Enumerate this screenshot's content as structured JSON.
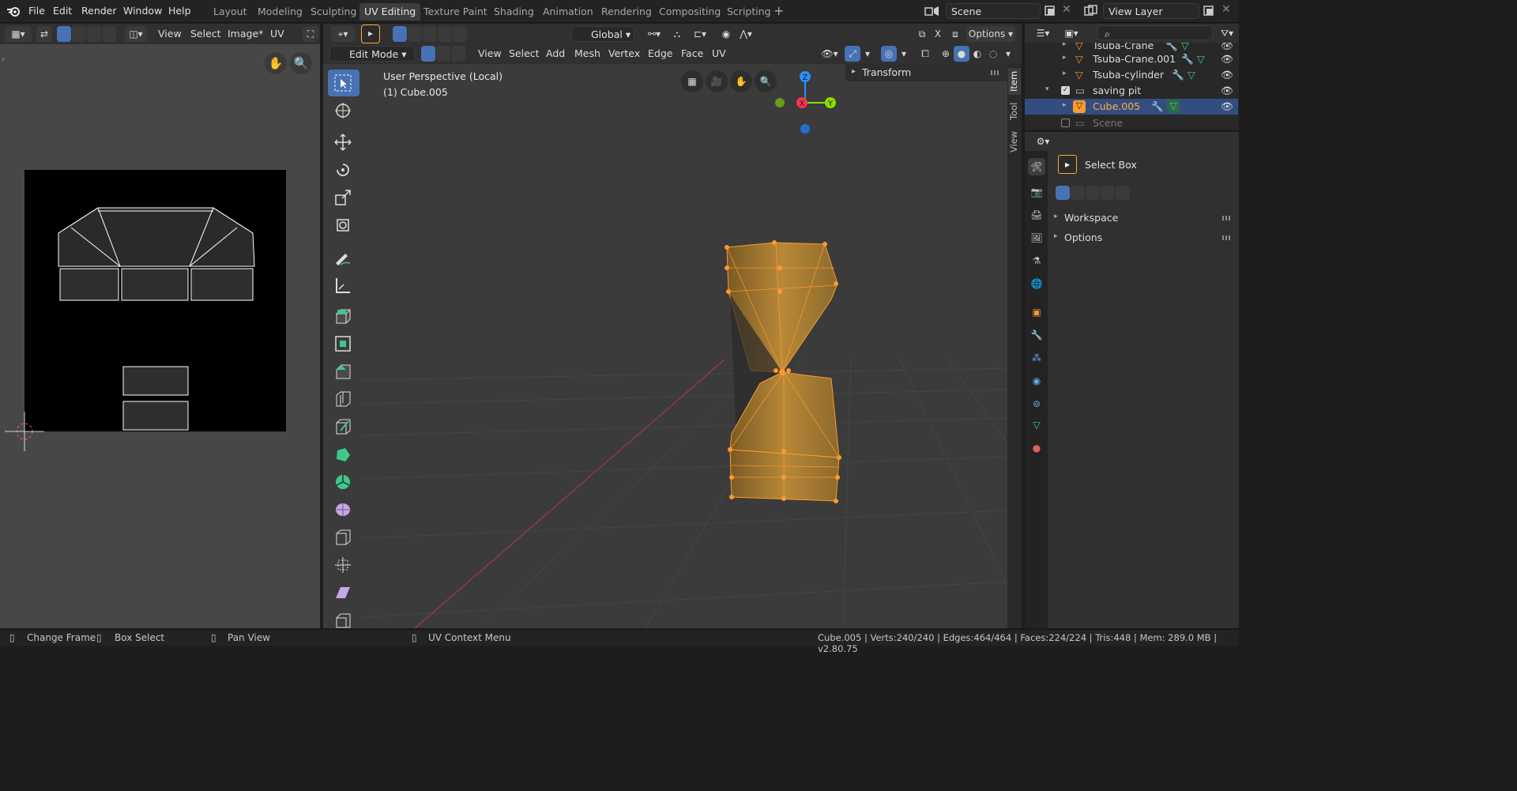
{
  "menus": [
    "File",
    "Edit",
    "Render",
    "Window",
    "Help"
  ],
  "workspaces": [
    "Layout",
    "Modeling",
    "Sculpting",
    "UV Editing",
    "Texture Paint",
    "Shading",
    "Animation",
    "Rendering",
    "Compositing",
    "Scripting"
  ],
  "active_workspace": "UV Editing",
  "scene": "Scene",
  "view_layer": "View Layer",
  "uv_editor": {
    "menus": [
      "View",
      "Select",
      "Image*",
      "UV"
    ]
  },
  "viewport": {
    "transform_orientation": "Global",
    "options_label": "Options",
    "mode": "Edit Mode",
    "menus": [
      "View",
      "Select",
      "Add",
      "Mesh",
      "Vertex",
      "Edge",
      "Face",
      "UV"
    ],
    "info_line1": "User Perspective (Local)",
    "info_line2": "(1) Cube.005",
    "n_panel_title": "Transform",
    "gizmo_axes": {
      "x": "X",
      "y": "Y",
      "z": "Z"
    },
    "side_tabs": [
      "Item",
      "Tool",
      "View"
    ]
  },
  "outliner": {
    "items": [
      {
        "label": "Tsuba-Crane",
        "selected": false
      },
      {
        "label": "Tsuba-Crane.001",
        "selected": false
      },
      {
        "label": "Tsuba-cylinder",
        "selected": false
      },
      {
        "label": "saving pit",
        "selected": false
      },
      {
        "label": "Cube.005",
        "selected": true
      },
      {
        "label": "Scene",
        "selected": false
      }
    ]
  },
  "properties": {
    "tool_name": "Select Box",
    "sections": [
      "Workspace",
      "Options"
    ]
  },
  "status": {
    "hints": [
      "Change Frame",
      "Box Select",
      "Pan View",
      "UV Context Menu"
    ],
    "stats": "Cube.005 | Verts:240/240 | Edges:464/464 | Faces:224/224 | Tris:448 | Mem: 289.0 MB | v2.80.75"
  },
  "colors": {
    "accent": "#4772b3",
    "selection": "#ff9a2e",
    "x_axis": "#ff3352",
    "y_axis": "#8bdc00",
    "z_axis": "#2890ff"
  }
}
